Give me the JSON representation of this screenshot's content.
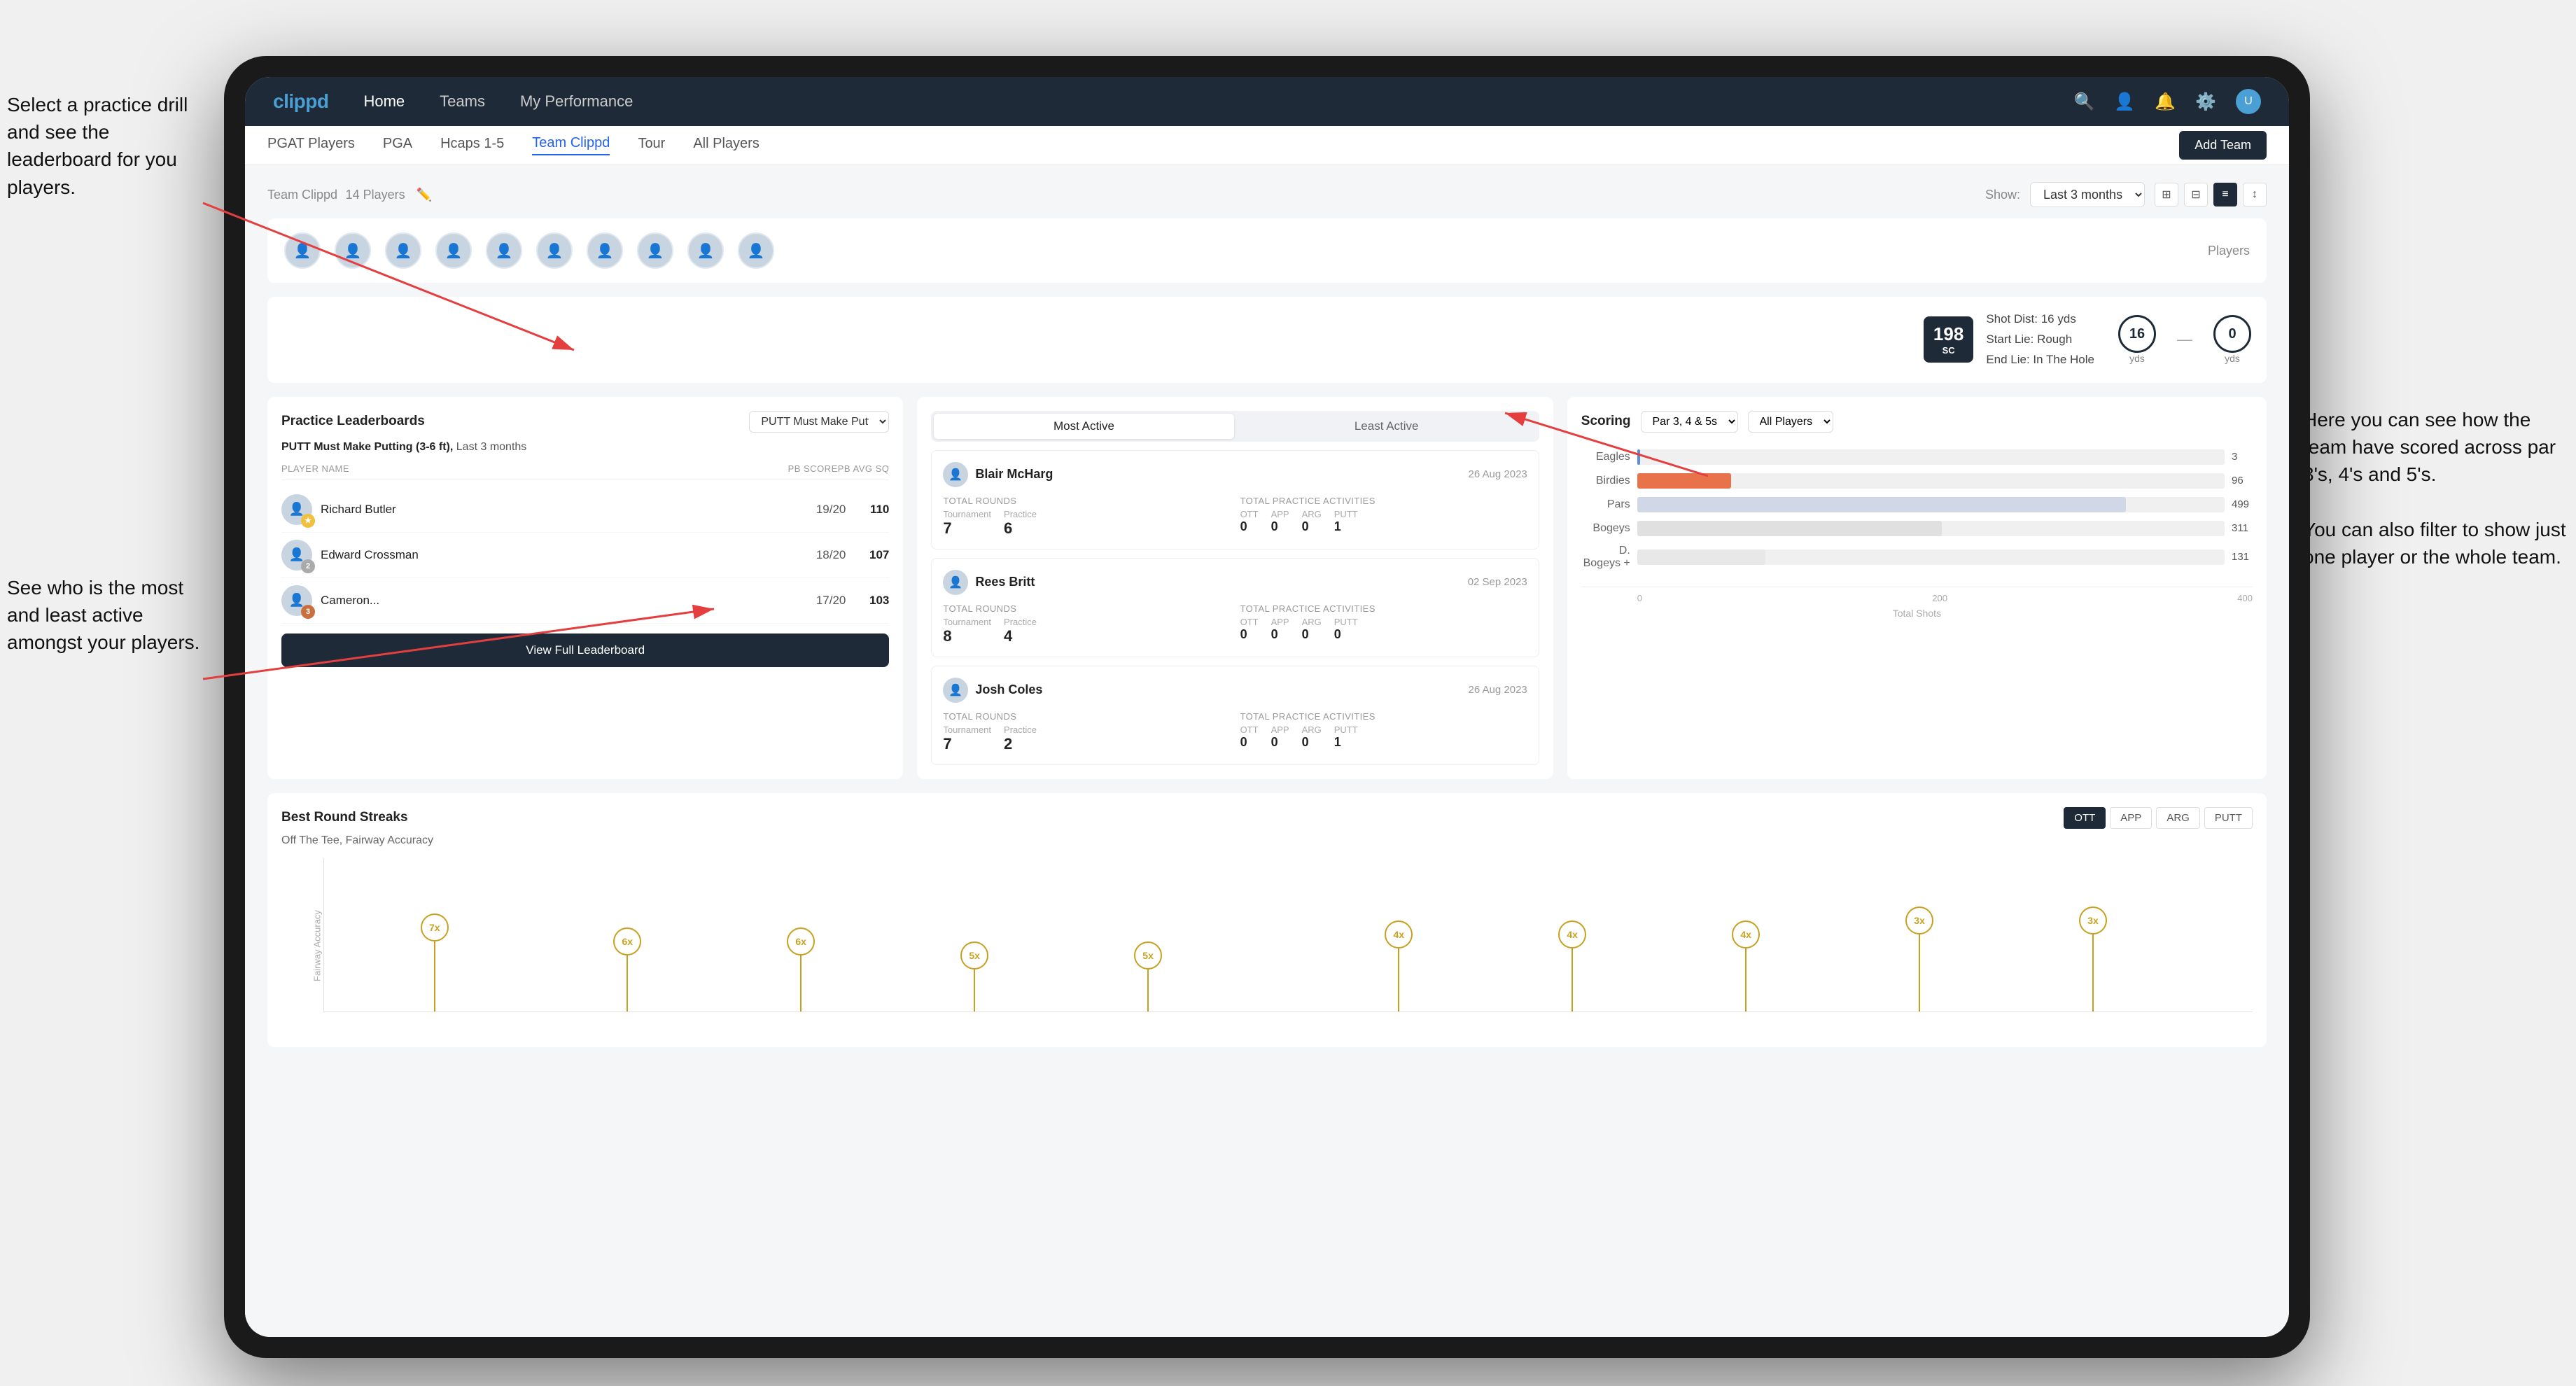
{
  "annotations": {
    "top_left": "Select a practice drill and see the leaderboard for you players.",
    "bottom_left": "See who is the most and least active amongst your players.",
    "right": "Here you can see how the team have scored across par 3's, 4's and 5's.\n\nYou can also filter to show just one player or the whole team."
  },
  "navbar": {
    "logo": "clippd",
    "items": [
      "Home",
      "Teams",
      "My Performance"
    ],
    "active": "Teams",
    "icons": [
      "search",
      "person",
      "bell",
      "settings",
      "avatar"
    ]
  },
  "subnav": {
    "items": [
      "PGAT Players",
      "PGA",
      "Hcaps 1-5",
      "Team Clippd",
      "Tour",
      "All Players"
    ],
    "active": "Team Clippd",
    "add_button": "Add Team"
  },
  "team_header": {
    "title": "Team Clippd",
    "player_count": "14 Players",
    "show_label": "Show:",
    "show_value": "Last 3 months",
    "view_options": [
      "grid-small",
      "grid-large",
      "list",
      "sort"
    ]
  },
  "players": {
    "label": "Players",
    "count": 10,
    "avatars": [
      "👤",
      "👤",
      "👤",
      "👤",
      "👤",
      "👤",
      "👤",
      "👤",
      "👤",
      "👤"
    ]
  },
  "shot_info": {
    "badge": "198",
    "badge_sub": "SC",
    "details_line1": "Shot Dist: 16 yds",
    "details_line2": "Start Lie: Rough",
    "details_line3": "End Lie: In The Hole",
    "yardage1": "16",
    "yardage1_label": "yds",
    "yardage2": "0",
    "yardage2_label": "yds",
    "vs": "—"
  },
  "practice_leaderboard": {
    "title": "Practice Leaderboards",
    "dropdown": "PUTT Must Make Putting ...",
    "subtitle": "PUTT Must Make Putting (3-6 ft),",
    "subtitle_period": "Last 3 months",
    "headers": [
      "PLAYER NAME",
      "PB SCORE",
      "PB AVG SQ"
    ],
    "players": [
      {
        "name": "Richard Butler",
        "score": "19/20",
        "avg": "110",
        "rank": 1,
        "badge_type": "gold",
        "badge_num": ""
      },
      {
        "name": "Edward Crossman",
        "score": "18/20",
        "avg": "107",
        "rank": 2,
        "badge_type": "silver",
        "badge_num": "2"
      },
      {
        "name": "Cameron...",
        "score": "17/20",
        "avg": "103",
        "rank": 3,
        "badge_type": "bronze",
        "badge_num": "3"
      }
    ],
    "view_button": "View Full Leaderboard"
  },
  "most_active": {
    "tabs": [
      "Most Active",
      "Least Active"
    ],
    "active_tab": "Most Active",
    "players": [
      {
        "name": "Blair McHarg",
        "date": "26 Aug 2023",
        "total_rounds_label": "Total Rounds",
        "tournament": "7",
        "practice": "6",
        "practice_label": "Practice",
        "tournament_label": "Tournament",
        "activities_label": "Total Practice Activities",
        "ott": "0",
        "app": "0",
        "arg": "0",
        "putt": "1"
      },
      {
        "name": "Rees Britt",
        "date": "02 Sep 2023",
        "total_rounds_label": "Total Rounds",
        "tournament": "8",
        "practice": "4",
        "practice_label": "Practice",
        "tournament_label": "Tournament",
        "activities_label": "Total Practice Activities",
        "ott": "0",
        "app": "0",
        "arg": "0",
        "putt": "0"
      },
      {
        "name": "Josh Coles",
        "date": "26 Aug 2023",
        "total_rounds_label": "Total Rounds",
        "tournament": "7",
        "practice": "2",
        "practice_label": "Practice",
        "tournament_label": "Tournament",
        "activities_label": "Total Practice Activities",
        "ott": "0",
        "app": "0",
        "arg": "0",
        "putt": "1"
      }
    ]
  },
  "scoring": {
    "title": "Scoring",
    "filter1": "Par 3, 4 & 5s",
    "filter2": "All Players",
    "chart_bars": [
      {
        "label": "Eagles",
        "value": 3,
        "max": 600,
        "type": "eagles",
        "show_val": "3"
      },
      {
        "label": "Birdies",
        "value": 96,
        "max": 600,
        "type": "birdies",
        "show_val": "96"
      },
      {
        "label": "Pars",
        "value": 499,
        "max": 600,
        "type": "pars",
        "show_val": "499"
      },
      {
        "label": "Bogeys",
        "value": 311,
        "max": 600,
        "type": "bogeys",
        "show_val": "311"
      },
      {
        "label": "D. Bogeys +",
        "value": 131,
        "max": 600,
        "type": "dbogeys",
        "show_val": "131"
      }
    ],
    "x_labels": [
      "0",
      "200",
      "400"
    ],
    "x_title": "Total Shots"
  },
  "streaks": {
    "title": "Best Round Streaks",
    "buttons": [
      "OTT",
      "APP",
      "ARG",
      "PUTT"
    ],
    "active_button": "OTT",
    "subtitle": "Off The Tee, Fairway Accuracy",
    "y_label": "Fairway Accuracy",
    "data_points": [
      {
        "x_pct": 5,
        "y_pct": 75,
        "line_h": 100,
        "label": "7x"
      },
      {
        "x_pct": 15,
        "y_pct": 55,
        "line_h": 80,
        "label": "6x"
      },
      {
        "x_pct": 24,
        "y_pct": 55,
        "line_h": 80,
        "label": "6x"
      },
      {
        "x_pct": 33,
        "y_pct": 40,
        "line_h": 60,
        "label": "5x"
      },
      {
        "x_pct": 42,
        "y_pct": 40,
        "line_h": 60,
        "label": "5x"
      },
      {
        "x_pct": 55,
        "y_pct": 65,
        "line_h": 90,
        "label": "4x"
      },
      {
        "x_pct": 64,
        "y_pct": 65,
        "line_h": 90,
        "label": "4x"
      },
      {
        "x_pct": 73,
        "y_pct": 65,
        "line_h": 90,
        "label": "4x"
      },
      {
        "x_pct": 82,
        "y_pct": 80,
        "line_h": 110,
        "label": "3x"
      },
      {
        "x_pct": 91,
        "y_pct": 80,
        "line_h": 110,
        "label": "3x"
      }
    ]
  }
}
